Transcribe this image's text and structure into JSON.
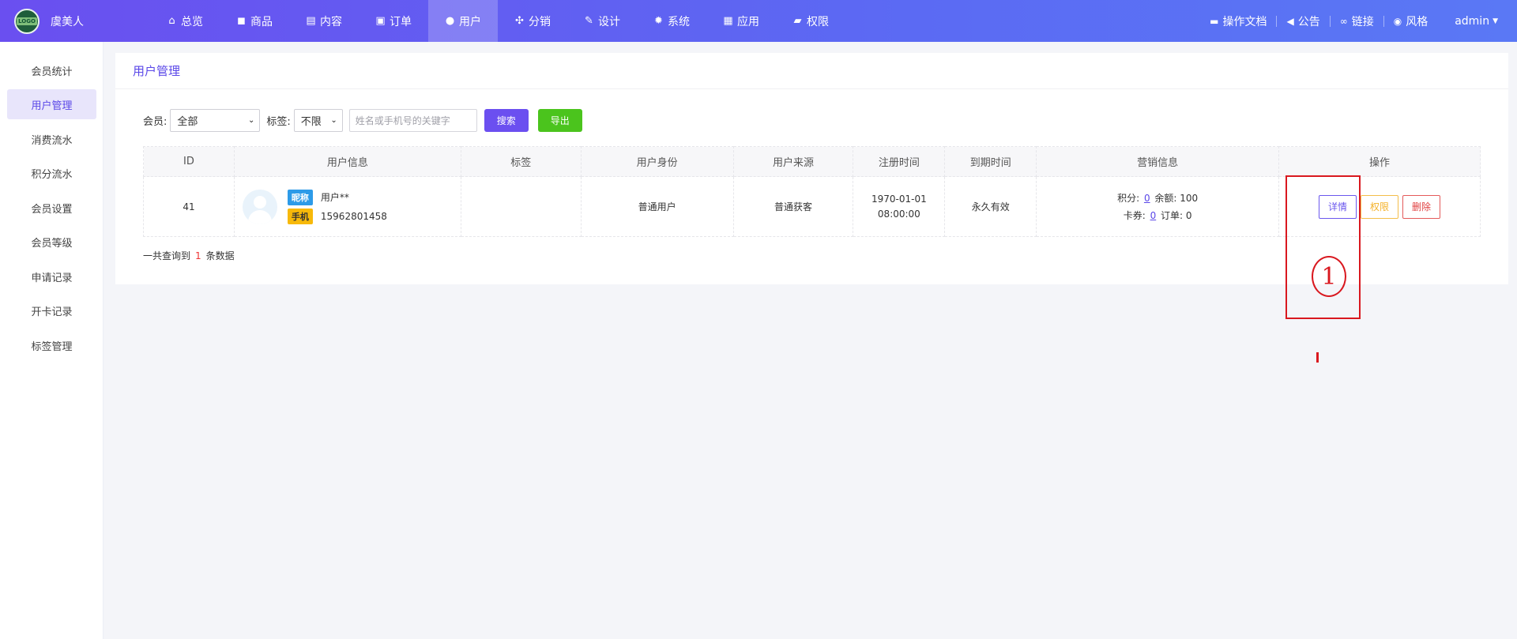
{
  "app": {
    "brand": "虞美人",
    "logo_text": "LOGO"
  },
  "nav": [
    {
      "label": "总览",
      "icon": "home-icon",
      "glyph": "⌂"
    },
    {
      "label": "商品",
      "icon": "bag-icon",
      "glyph": "◼"
    },
    {
      "label": "内容",
      "icon": "document-icon",
      "glyph": "▤"
    },
    {
      "label": "订单",
      "icon": "clipboard-icon",
      "glyph": "▣"
    },
    {
      "label": "用户",
      "icon": "user-icon",
      "glyph": "●",
      "active": true
    },
    {
      "label": "分销",
      "icon": "share-icon",
      "glyph": "✣"
    },
    {
      "label": "设计",
      "icon": "brush-icon",
      "glyph": "✎"
    },
    {
      "label": "系统",
      "icon": "gear-icon",
      "glyph": "✹"
    },
    {
      "label": "应用",
      "icon": "grid-icon",
      "glyph": "▦"
    },
    {
      "label": "权限",
      "icon": "lock-icon",
      "glyph": "▰"
    }
  ],
  "right_menu": {
    "docs": "操作文档",
    "notice": "公告",
    "links": "链接",
    "style": "风格",
    "user": "admin"
  },
  "sidebar": [
    {
      "label": "会员统计"
    },
    {
      "label": "用户管理",
      "active": true
    },
    {
      "label": "消费流水"
    },
    {
      "label": "积分流水"
    },
    {
      "label": "会员设置"
    },
    {
      "label": "会员等级"
    },
    {
      "label": "申请记录"
    },
    {
      "label": "开卡记录"
    },
    {
      "label": "标签管理"
    }
  ],
  "page": {
    "title": "用户管理"
  },
  "filters": {
    "member_label": "会员:",
    "member_value": "全部",
    "tag_label": "标签:",
    "tag_value": "不限",
    "keyword_placeholder": "姓名或手机号的关键字",
    "search_label": "搜索",
    "export_label": "导出"
  },
  "table": {
    "headers": [
      "ID",
      "用户信息",
      "标签",
      "用户身份",
      "用户来源",
      "注册时间",
      "到期时间",
      "营销信息",
      "操作"
    ],
    "rows": [
      {
        "id": "41",
        "nickname_badge": "昵称",
        "nickname": "用户**",
        "phone_badge": "手机",
        "phone": "15962801458",
        "tag": "",
        "identity": "普通用户",
        "source": "普通获客",
        "reg_date": "1970-01-01",
        "reg_time": "08:00:00",
        "expire": "永久有效",
        "points_label": "积分:",
        "points": "0",
        "balance_label": "余额:",
        "balance": "100",
        "coupons_label": "卡券:",
        "coupons": "0",
        "orders_label": "订单:",
        "orders": "0",
        "actions": {
          "detail": "详情",
          "perm": "权限",
          "delete": "删除"
        }
      }
    ]
  },
  "summary": {
    "prefix": "一共查询到",
    "count": "1",
    "suffix": "条数据"
  },
  "annotation": {
    "number": "1"
  },
  "colors": {
    "accent": "#5a47e8",
    "topbar": "#6a4ff0",
    "export": "#4bc41d",
    "annotation": "#d9181f"
  }
}
